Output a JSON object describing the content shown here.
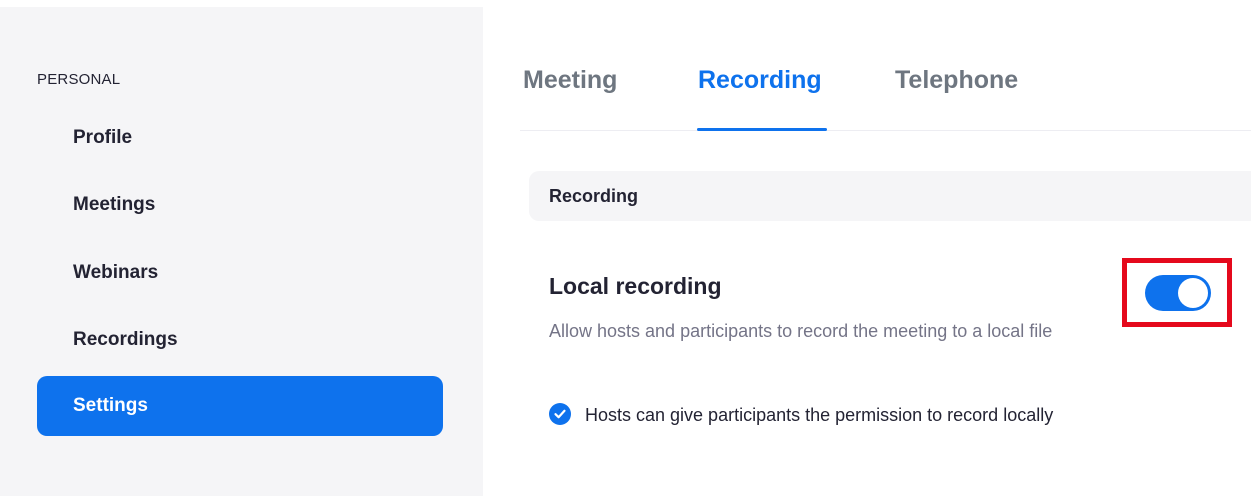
{
  "sidebar": {
    "section_label": "PERSONAL",
    "items": [
      {
        "label": "Profile",
        "active": false
      },
      {
        "label": "Meetings",
        "active": false
      },
      {
        "label": "Webinars",
        "active": false
      },
      {
        "label": "Recordings",
        "active": false
      },
      {
        "label": "Settings",
        "active": true
      }
    ]
  },
  "tabs": [
    {
      "label": "Meeting",
      "active": false
    },
    {
      "label": "Recording",
      "active": true
    },
    {
      "label": "Telephone",
      "active": false
    }
  ],
  "section": {
    "title": "Recording",
    "setting": {
      "title": "Local recording",
      "description": "Allow hosts and participants to record the meeting to a local file",
      "toggle_on": true,
      "option": {
        "label": "Hosts can give participants the permission to record locally",
        "checked": true
      }
    }
  },
  "colors": {
    "accent": "#0e72ed",
    "highlight": "#e5091c",
    "sidebar_bg": "#f5f5f7"
  },
  "icons": {
    "checkbox": "check-icon"
  }
}
